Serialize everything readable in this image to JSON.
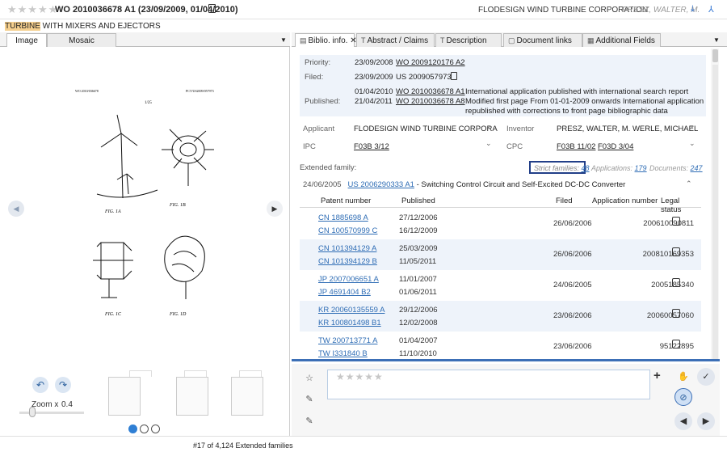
{
  "header": {
    "rating_stars": "★★★★★",
    "pub_title": "WO 2010036678 A1 (23/09/2009, 01/04/2010)",
    "company": "FLODESIGN WIND TURBINE CORPORATION",
    "inventors": "PRESZ, WALTER, M.",
    "action_icon_1": "export-icon",
    "action_icon_2": "pin-icon",
    "icon_glyph_1": "⤓",
    "icon_glyph_2": "⅄"
  },
  "subtitle": {
    "highlight": "TURBINE",
    "rest": " WITH MIXERS AND EJECTORS"
  },
  "left_panel": {
    "tabs": [
      "Image",
      "Mosaic"
    ],
    "menu_glyph": "▼",
    "drawing_header_left": "WO 2010/036678",
    "drawing_header_right": "PCT/US2009/057973",
    "drawing_page": "1/25",
    "fig_labels": [
      "FIG. 1A",
      "FIG. 1B",
      "FIG. 1C",
      "FIG. 1D"
    ],
    "prev_glyph": "◀",
    "next_glyph": "▶",
    "rotate_left_glyph": "↶",
    "rotate_right_glyph": "↷",
    "zoom_label": "Zoom x",
    "zoom_value": "0.4",
    "page_count": 3,
    "current_page": 1
  },
  "biblio": {
    "tabs": [
      {
        "label": "Biblio. info.",
        "icon": "document-icon",
        "glyph": "▤",
        "close": "✕"
      },
      {
        "label": "Abstract / Claims",
        "icon": "text-icon",
        "glyph": "T"
      },
      {
        "label": "Description",
        "icon": "text-icon",
        "glyph": "T"
      },
      {
        "label": "Document links",
        "icon": "link-doc-icon",
        "glyph": "▢"
      },
      {
        "label": "Additional Fields",
        "icon": "fields-icon",
        "glyph": "▦"
      }
    ],
    "priority_label": "Priority:",
    "priority_date": "23/09/2008",
    "priority_doc": "WO 2009120176 A2",
    "filed_label": "Filed:",
    "filed_date": "23/09/2009",
    "filed_doc": "US 2009057973",
    "published_label": "Published:",
    "pub_dates": [
      "01/04/2010",
      "21/04/2011"
    ],
    "pub_docs": [
      "WO 2010036678 A1",
      "WO 2010036678 A8"
    ],
    "pub_notes": [
      "International application published with international search report",
      "Modified first page  From 01-01-2009 onwards International application",
      "republished with corrections to front page  bibliographic data"
    ],
    "applicant_label": "Applicant",
    "applicant_value": "FLODESIGN WIND TURBINE CORPORA",
    "inventor_label": "Inventor",
    "inventor_value": "PRESZ, WALTER, M.   WERLE, MICHAEL",
    "ipc_label": "IPC",
    "ipc_value": "F03B 3/12",
    "cpc_label": "CPC",
    "cpc_values": [
      "F03B 11/02",
      "F03D 3/04"
    ],
    "dropdown_glyph": "⌄"
  },
  "family": {
    "label": "Extended family:",
    "strict_label": "Strict families:",
    "strict_count": "48",
    "apps_label": "Applications:",
    "apps_count": "179",
    "docs_label": "Documents:",
    "docs_count": "247",
    "head_date": "24/06/2005",
    "head_doc": "US 2006290333 A1",
    "head_title": " - Switching Control Circuit and Self-Excited DC-DC Converter",
    "collapse_glyph": "⌃",
    "columns": [
      "Patent number",
      "Published",
      "Filed",
      "Application number",
      "Legal status"
    ],
    "rows": [
      {
        "nums": [
          "CN 1885698 A",
          "CN 100570999 C"
        ],
        "pubs": [
          "27/12/2006",
          "16/12/2009"
        ],
        "filed": "26/06/2006",
        "appno": "200610090811"
      },
      {
        "nums": [
          "CN 101394129 A",
          "CN 101394129 B"
        ],
        "pubs": [
          "25/03/2009",
          "11/05/2011"
        ],
        "filed": "26/06/2006",
        "appno": "200810169353"
      },
      {
        "nums": [
          "JP 2007006651 A",
          "JP 4691404 B2"
        ],
        "pubs": [
          "11/01/2007",
          "01/06/2011"
        ],
        "filed": "24/06/2005",
        "appno": "2005185340"
      },
      {
        "nums": [
          "KR 20060135559 A",
          "KR 100801498 B1"
        ],
        "pubs": [
          "29/12/2006",
          "12/02/2008"
        ],
        "filed": "23/06/2006",
        "appno": "20060057060"
      },
      {
        "nums": [
          "TW 200713771 A",
          "TW I331840 B"
        ],
        "pubs": [
          "01/04/2007",
          "11/10/2010"
        ],
        "filed": "23/06/2006",
        "appno": "95122895"
      }
    ]
  },
  "comments": {
    "stars": "★★★★★",
    "add_glyph": "+",
    "side_icons": [
      "user-star-icon",
      "note-edit-icon",
      "note-edit-icon"
    ],
    "side_glyphs": [
      "☆",
      "✎",
      "✎"
    ],
    "thumb_down_glyph": "✋",
    "check_glyph": "✓",
    "block_glyph": "⊘",
    "prev_glyph": "◀",
    "next_glyph": "▶"
  },
  "footer": {
    "text": "#17 of 4,124 Extended families"
  },
  "colors": {
    "accent": "#3c6fb6",
    "link": "#2f6db5",
    "highlight": "#f5cf8e",
    "alt_row": "#eef3fa"
  }
}
